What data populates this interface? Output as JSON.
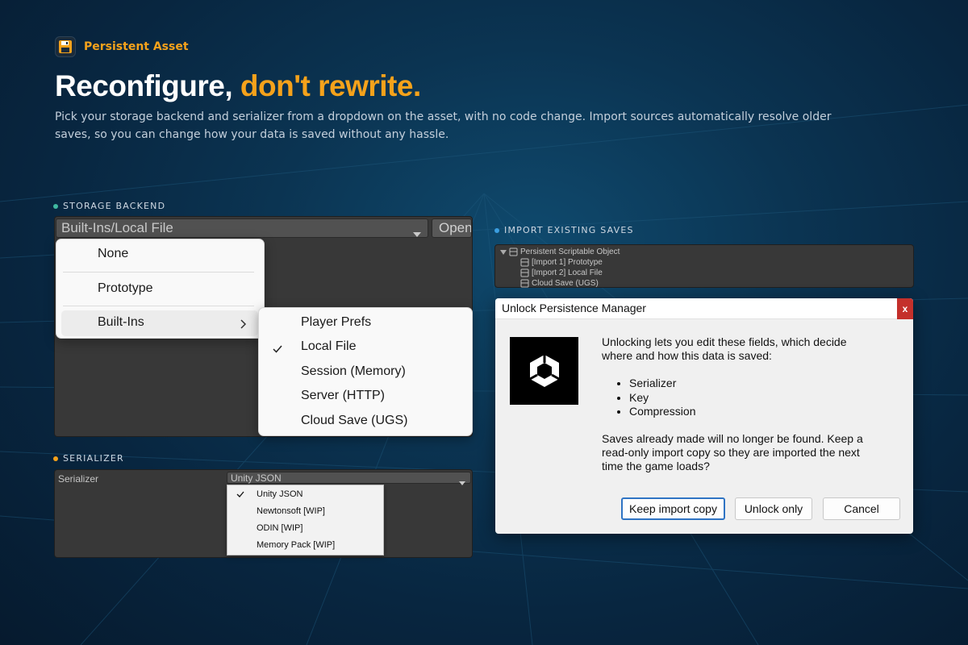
{
  "brand": {
    "name": "Persistent Asset",
    "icon": "floppy-disk-icon",
    "accent_color": "#f5a21b"
  },
  "headline": {
    "main": "Reconfigure,",
    "accent": "don't rewrite."
  },
  "description": "Pick your storage backend and serializer from a dropdown on the asset, with no code change. Import sources automatically resolve older saves, so you can change how your data is saved without any hassle.",
  "storage": {
    "section_label": "STORAGE BACKEND",
    "dot_color": "#3fb8a0",
    "selected": "Built-Ins/Local File",
    "open_label": "Open",
    "menu": [
      "None",
      "Prototype",
      "Built-Ins"
    ],
    "submenu": [
      "Player Prefs",
      "Local File",
      "Session (Memory)",
      "Server (HTTP)",
      "Cloud Save (UGS)"
    ],
    "submenu_checked": "Local File"
  },
  "serializer": {
    "section_label": "SERIALIZER",
    "dot_color": "#f5a21b",
    "field_label": "Serializer",
    "selected": "Unity JSON",
    "options": [
      "Unity JSON",
      "Newtonsoft [WIP]",
      "ODIN [WIP]",
      "Memory Pack [WIP]"
    ],
    "checked": "Unity JSON"
  },
  "import": {
    "section_label": "IMPORT EXISTING SAVES",
    "dot_color": "#3b9ee0",
    "tree_root": "Persistent Scriptable Object",
    "tree_children": [
      "[Import 1] Prototype",
      "[Import 2] Local File",
      "Cloud Save (UGS)"
    ]
  },
  "dialog": {
    "title": "Unlock Persistence Manager",
    "close": "x",
    "logo": "unity-logo",
    "intro": "Unlocking lets you edit these fields, which decide where and how this data is saved:",
    "bullets": [
      "Serializer",
      "Key",
      "Compression"
    ],
    "warning": "Saves already made will no longer be found. Keep a read-only import copy so they are imported the next time the game loads?",
    "buttons": {
      "keep": "Keep import copy",
      "unlock": "Unlock only",
      "cancel": "Cancel"
    }
  }
}
